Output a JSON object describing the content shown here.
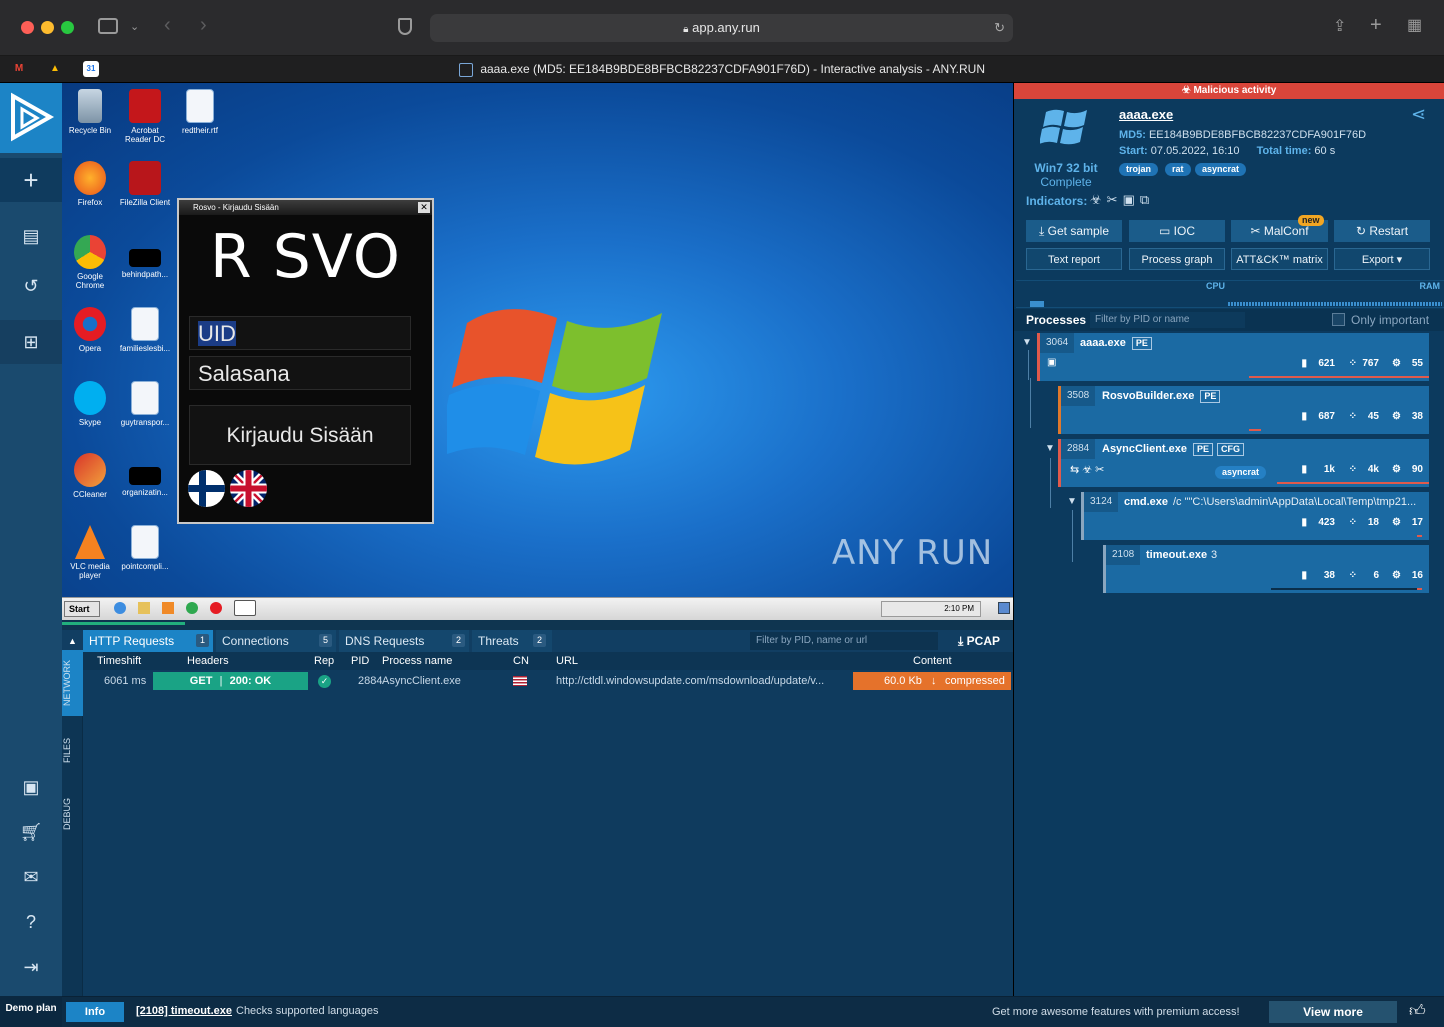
{
  "browser": {
    "url": "app.any.run",
    "tab_title": "aaaa.exe (MD5: EE184B9BDE8BFBCB82237CDFA901F76D) - Interactive analysis - ANY.RUN",
    "bookmarks": [
      "M",
      "▲",
      "31"
    ]
  },
  "desktop": {
    "icons": [
      {
        "label": "Recycle Bin"
      },
      {
        "label": "Acrobat Reader DC"
      },
      {
        "label": "redtheir.rtf"
      },
      {
        "label": "Firefox"
      },
      {
        "label": "FileZilla Client"
      },
      {
        "label": "Google Chrome"
      },
      {
        "label": "behindpath..."
      },
      {
        "label": "Opera"
      },
      {
        "label": "familieslesbi..."
      },
      {
        "label": "Skype"
      },
      {
        "label": "guytranspor..."
      },
      {
        "label": "CCleaner"
      },
      {
        "label": "organizatin..."
      },
      {
        "label": "VLC media player"
      },
      {
        "label": "pointcompli..."
      }
    ],
    "watermark": "ANY RUN",
    "rosvo": {
      "title": "Rosvo - Kirjaudu Sisään",
      "logo": "R SVO",
      "uid": "UID",
      "password": "Salasana",
      "login": "Kirjaudu Sisään"
    },
    "taskbar": {
      "start": "Start",
      "time": "2:10 PM"
    }
  },
  "network": {
    "tabs": [
      {
        "label": "HTTP Requests",
        "count": "1"
      },
      {
        "label": "Connections",
        "count": "5"
      },
      {
        "label": "DNS Requests",
        "count": "2"
      },
      {
        "label": "Threats",
        "count": "2"
      }
    ],
    "filter_placeholder": "Filter by PID, name or url",
    "pcap": "PCAP",
    "side_tabs": [
      "NETWORK",
      "FILES",
      "DEBUG"
    ],
    "columns": [
      "Timeshift",
      "Headers",
      "Rep",
      "PID",
      "Process name",
      "CN",
      "URL",
      "Content"
    ],
    "row": {
      "timeshift": "6061 ms",
      "method": "GET",
      "status": "200: OK",
      "pid": "2884",
      "process": "AsyncClient.exe",
      "url": "http://ctldl.windowsupdate.com/msdownload/update/v...",
      "size": "60.0 Kb",
      "content": "compressed"
    }
  },
  "status_bar": {
    "plan": "Demo plan",
    "info": "Info",
    "message_proc": "[2108] timeout.exe",
    "message_text": "Checks supported languages",
    "promo": "Get more awesome features with premium access!",
    "view_more": "View more"
  },
  "analysis": {
    "banner": "Malicious activity",
    "filename": "aaaa.exe",
    "md5_label": "MD5:",
    "md5": "EE184B9BDE8BFBCB82237CDFA901F76D",
    "start_label": "Start:",
    "start": "07.05.2022, 16:10",
    "total_label": "Total time:",
    "total": "60 s",
    "os": "Win7 32 bit",
    "os_status": "Complete",
    "tags": [
      "trojan",
      "rat",
      "asyncrat"
    ],
    "indicators_label": "Indicators:",
    "buttons": [
      "Get sample",
      "IOC",
      "MalConf",
      "Restart"
    ],
    "new_badge": "new",
    "buttons2": [
      "Text report",
      "Process graph",
      "ATT&CK™ matrix",
      "Export"
    ],
    "cpu_label": "CPU",
    "ram_label": "RAM",
    "processes_label": "Processes",
    "process_filter_placeholder": "Filter by PID or name",
    "only_important": "Only important",
    "processes": [
      {
        "pid": "3064",
        "name": "aaaa.exe",
        "badges": [
          "PE"
        ],
        "cmd": "",
        "stats": [
          "621",
          "767",
          "55"
        ],
        "tag": ""
      },
      {
        "pid": "3508",
        "name": "RosvoBuilder.exe",
        "badges": [
          "PE"
        ],
        "cmd": "",
        "stats": [
          "687",
          "45",
          "38"
        ],
        "tag": ""
      },
      {
        "pid": "2884",
        "name": "AsyncClient.exe",
        "badges": [
          "PE",
          "CFG"
        ],
        "cmd": "",
        "stats": [
          "1k",
          "4k",
          "90"
        ],
        "tag": "asyncrat"
      },
      {
        "pid": "3124",
        "name": "cmd.exe",
        "badges": [],
        "cmd": "/c \"\"C:\\Users\\admin\\AppData\\Local\\Temp\\tmp21...",
        "stats": [
          "423",
          "18",
          "17"
        ],
        "tag": ""
      },
      {
        "pid": "2108",
        "name": "timeout.exe",
        "badges": [],
        "cmd": "3",
        "stats": [
          "38",
          "6",
          "16"
        ],
        "tag": ""
      }
    ]
  },
  "colors": {
    "accent": "#1c84c6",
    "malicious": "#d9453a",
    "ok_green": "#1aa385",
    "content_orange": "#e5722b"
  }
}
